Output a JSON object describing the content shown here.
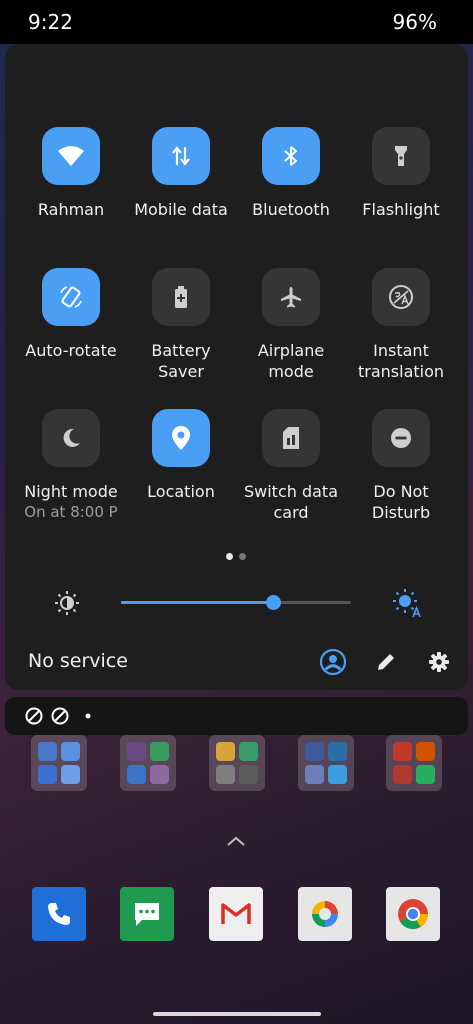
{
  "status": {
    "time": "9:22",
    "battery": "96%"
  },
  "tiles": [
    {
      "label": "Rahman",
      "sub": "",
      "state": "on",
      "icon": "wifi-icon"
    },
    {
      "label": "Mobile data",
      "sub": "",
      "state": "on",
      "icon": "mobile-data-icon"
    },
    {
      "label": "Bluetooth",
      "sub": "",
      "state": "on",
      "icon": "bluetooth-icon"
    },
    {
      "label": "Flashlight",
      "sub": "",
      "state": "off",
      "icon": "flashlight-icon"
    },
    {
      "label": "Auto-rotate",
      "sub": "",
      "state": "on",
      "icon": "auto-rotate-icon"
    },
    {
      "label": "Battery Saver",
      "sub": "",
      "state": "off",
      "icon": "battery-saver-icon"
    },
    {
      "label": "Airplane mode",
      "sub": "",
      "state": "off",
      "icon": "airplane-icon"
    },
    {
      "label": "Instant translation",
      "sub": "",
      "state": "off",
      "icon": "translate-icon"
    },
    {
      "label": "Night mode",
      "sub": "On at 8:00 P",
      "state": "off",
      "icon": "moon-icon"
    },
    {
      "label": "Location",
      "sub": "",
      "state": "on",
      "icon": "location-pin-icon"
    },
    {
      "label": "Switch data card",
      "sub": "",
      "state": "off",
      "icon": "sim-card-icon"
    },
    {
      "label": "Do Not Disturb",
      "sub": "",
      "state": "off",
      "icon": "do-not-disturb-icon"
    }
  ],
  "brightness": {
    "level": 0.66
  },
  "footer": {
    "carrier": "No service"
  },
  "colors": {
    "accent": "#4a9ff5",
    "panel": "#1e1e1e",
    "tile_off": "#353535"
  }
}
